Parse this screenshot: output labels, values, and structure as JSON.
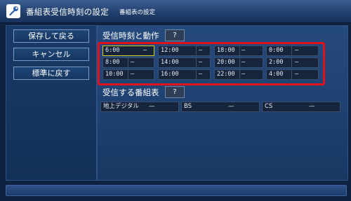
{
  "header": {
    "title": "番組表受信時刻の設定",
    "subtitle": "番組表の設定",
    "icon": "wrench-icon"
  },
  "sidebar": {
    "buttons": [
      {
        "label": "保存して戻る"
      },
      {
        "label": "キャンセル"
      },
      {
        "label": "標準に戻す"
      }
    ]
  },
  "schedule": {
    "label": "受信時刻と動作",
    "help": "?",
    "cells": [
      {
        "time": "6:00",
        "action": "—"
      },
      {
        "time": "12:00",
        "action": "—"
      },
      {
        "time": "18:00",
        "action": "—"
      },
      {
        "time": "0:00",
        "action": "—"
      },
      {
        "time": "8:00",
        "action": "—"
      },
      {
        "time": "14:00",
        "action": "—"
      },
      {
        "time": "20:00",
        "action": "—"
      },
      {
        "time": "2:00",
        "action": "—"
      },
      {
        "time": "10:00",
        "action": "—"
      },
      {
        "time": "16:00",
        "action": "—"
      },
      {
        "time": "22:00",
        "action": "—"
      },
      {
        "time": "4:00",
        "action": "—"
      }
    ]
  },
  "guides": {
    "label": "受信する番組表",
    "help": "?",
    "items": [
      {
        "name": "地上デジタル",
        "value": "—"
      },
      {
        "name": "BS",
        "value": "—"
      },
      {
        "name": "CS",
        "value": "—"
      }
    ]
  },
  "colors": {
    "highlight_frame": "#e0101c",
    "selected_cell": "#d8d020"
  }
}
